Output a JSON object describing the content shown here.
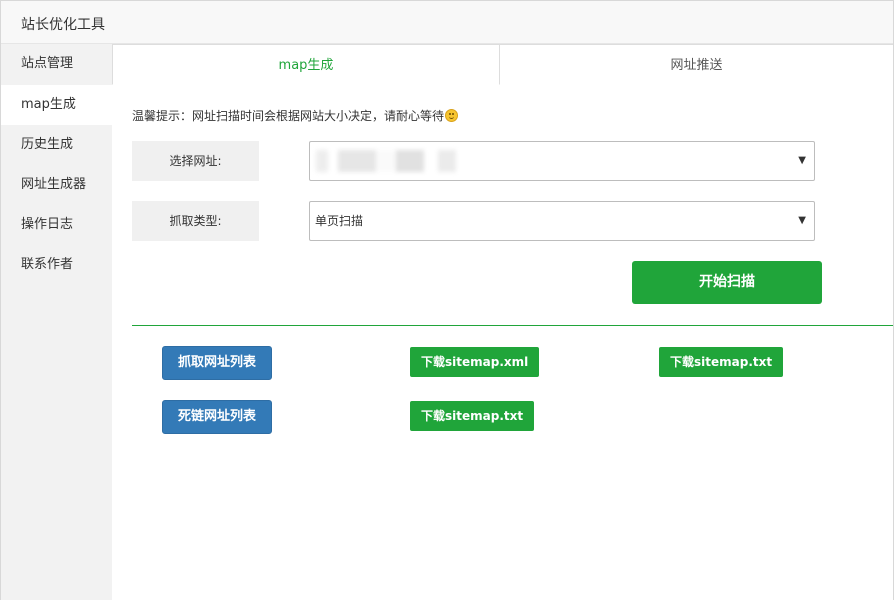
{
  "window": {
    "title": "站长优化工具"
  },
  "sidebar": {
    "items": [
      {
        "label": "站点管理"
      },
      {
        "label": "map生成"
      },
      {
        "label": "历史生成"
      },
      {
        "label": "网址生成器"
      },
      {
        "label": "操作日志"
      },
      {
        "label": "联系作者"
      }
    ],
    "active": "map生成"
  },
  "tabs": [
    {
      "label": "map生成",
      "active": true
    },
    {
      "label": "网址推送",
      "active": false
    }
  ],
  "tip": {
    "text": "温馨提示：网址扫描时间会根据网站大小决定，请耐心等待"
  },
  "form": {
    "site_label": "选择网址:",
    "site_value": "",
    "crawl_label": "抓取类型:",
    "crawl_value": "单页扫描"
  },
  "buttons": {
    "start_scan": "开始扫描",
    "crawl_list": "抓取网址列表",
    "dead_list": "死链网址列表",
    "download_xml": "下载sitemap.xml",
    "download_txt": "下载sitemap.txt",
    "download_txt2": "下载sitemap.txt"
  },
  "colors": {
    "accent_green": "#20a53a",
    "button_blue": "#337ab7",
    "sidebar_bg": "#f2f2f2"
  },
  "icons": {
    "smiley": "smiley-icon",
    "dropdown": "caret-down-icon"
  }
}
